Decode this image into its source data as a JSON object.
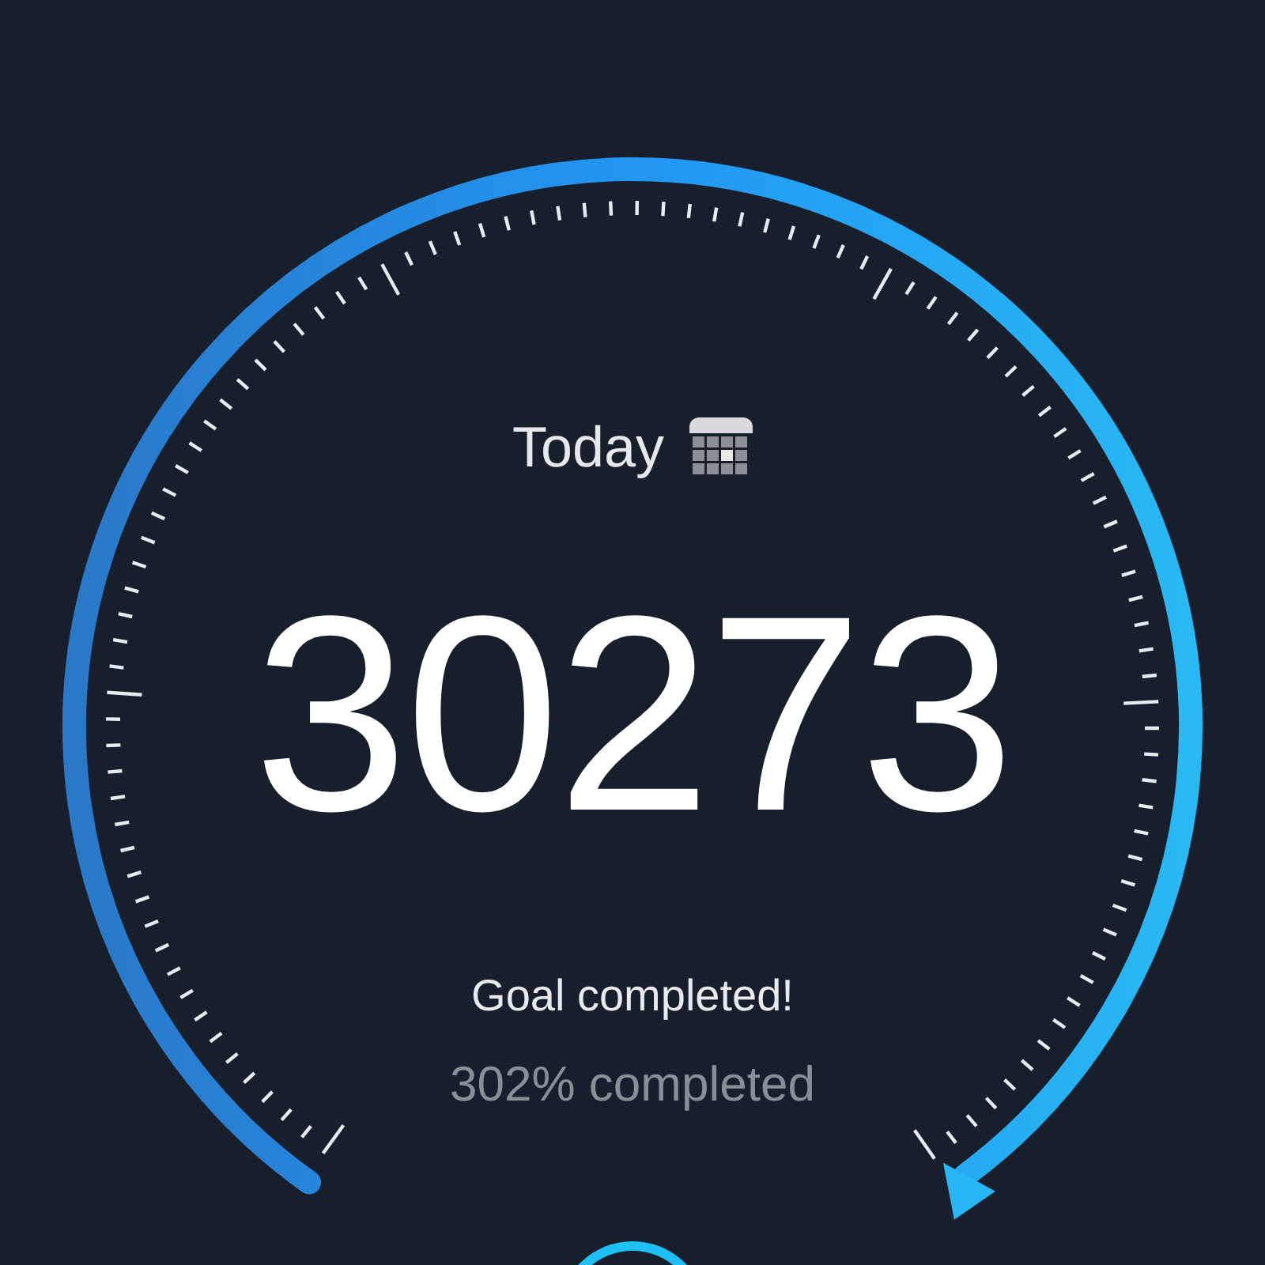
{
  "header": {
    "title": "Today"
  },
  "steps": "30273",
  "status": "Goal completed!",
  "progress_text": "302% completed"
}
